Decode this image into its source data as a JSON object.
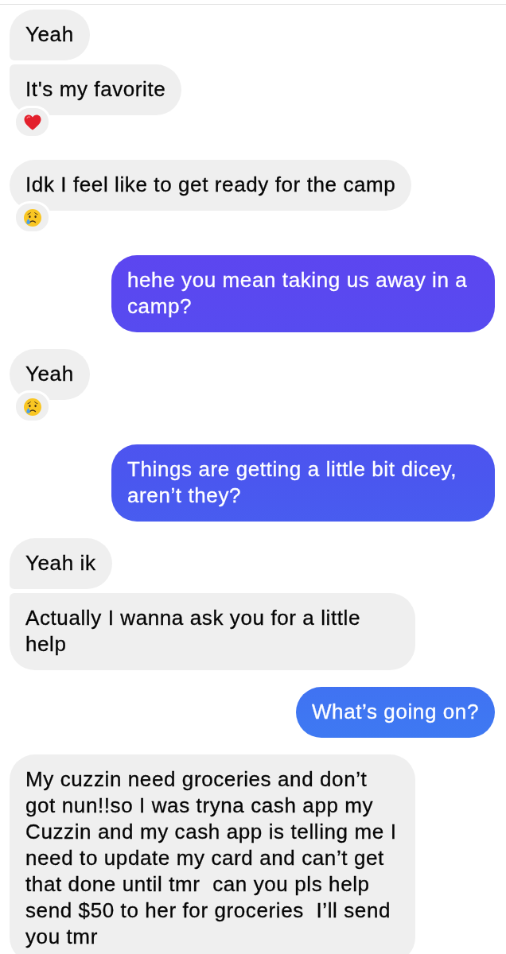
{
  "messages": [
    {
      "kind": "incoming",
      "text": "Yeah"
    },
    {
      "kind": "incoming",
      "text": "It's my favorite",
      "reaction": {
        "kind": "heart"
      }
    },
    {
      "kind": "incoming",
      "text": "Idk I feel like to get ready for the camp",
      "reaction": {
        "kind": "crying"
      }
    },
    {
      "kind": "outgoing",
      "text": "hehe you mean taking us away in a camp?"
    },
    {
      "kind": "incoming",
      "text": "Yeah",
      "reaction": {
        "kind": "crying"
      }
    },
    {
      "kind": "outgoing",
      "text": "Things are getting a little bit dicey, aren’t they?"
    },
    {
      "kind": "incoming",
      "text": "Yeah ik"
    },
    {
      "kind": "incoming",
      "text": "Actually I wanna ask you for a little help"
    },
    {
      "kind": "outgoing",
      "text": "What’s going on?"
    },
    {
      "kind": "incoming",
      "text": "My cuzzin need groceries and don’t got nun!!so I was tryna cash app my Cuzzin and my cash app is telling me I need to update my card and can’t get that done until tmr  can you pls help send $50 to her for groceries  I’ll send you tmr"
    }
  ]
}
